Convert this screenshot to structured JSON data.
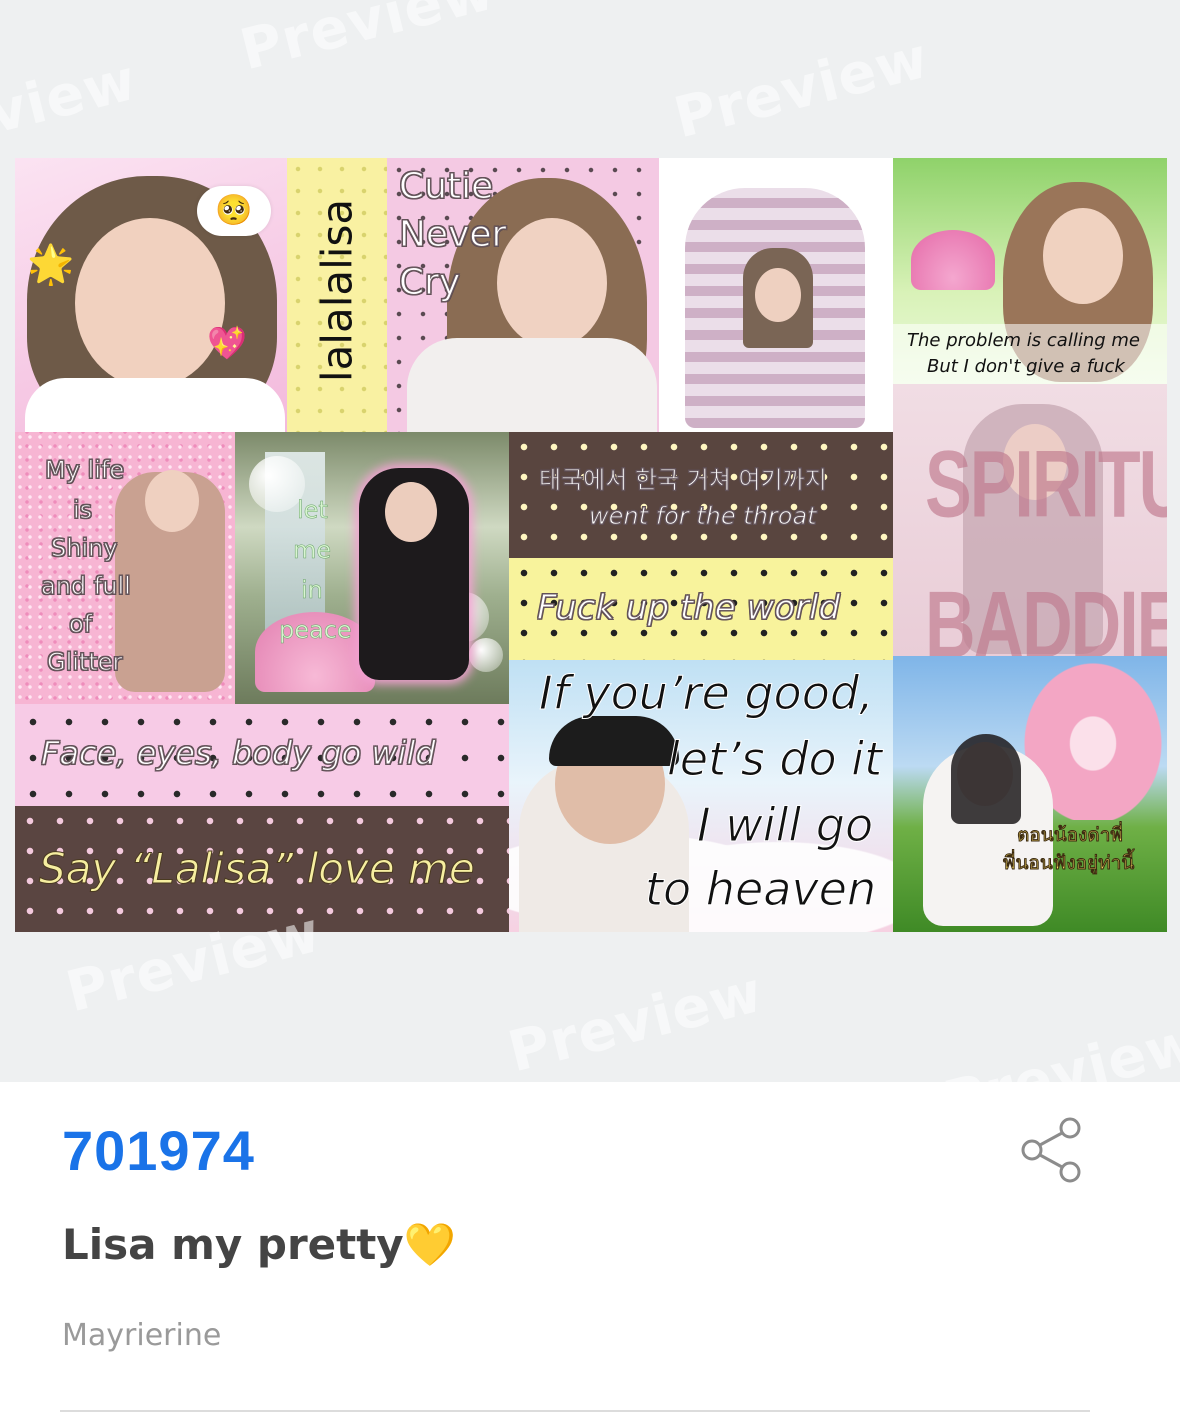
{
  "colors": {
    "accent_blue": "#1a73e8",
    "preview_bg": "#eef0f1",
    "title_text": "#444444",
    "author_text": "#9a9a9a"
  },
  "watermark": {
    "text": "Preview"
  },
  "collage": {
    "tile1": {
      "emoji": "🥺",
      "star": "🌟",
      "heart": "💖"
    },
    "tile2": {
      "text": "lalalalisa"
    },
    "tile3": {
      "line1": "Cutie",
      "line2": "Never",
      "line3": "Cry"
    },
    "tile5": {
      "line1": "The problem is calling me",
      "line2": "But I don't give a fuck"
    },
    "tile6": {
      "line1": "My life",
      "line2": "is",
      "line3": "Shiny",
      "line4": "and full",
      "line5": "of",
      "line6": "Glitter"
    },
    "tile7": {
      "line1": "let",
      "line2": "me",
      "line3": "in",
      "line4": "peace"
    },
    "tile8": {
      "line1": "태국에서 한국 거쳐 여기까지",
      "line2": "went for the throat"
    },
    "tile9": {
      "text": "SPIRITUAL BADDIE"
    },
    "tile10": {
      "text": "Fuck up the world"
    },
    "tile11": {
      "text": "Face, eyes, body go wild"
    },
    "tile12": {
      "line1": "If you’re good,",
      "line2": "let’s do it",
      "line3": "I will go",
      "line4": "to heaven"
    },
    "tile13": {
      "line1": "ตอนน้องด่าพี่",
      "line2": "พี่นอนฟังอยู่ท่านี้"
    },
    "tile14": {
      "text": "Say “Lalisa” love me"
    }
  },
  "post": {
    "id": "701974",
    "title": "Lisa my pretty💛",
    "author": "Mayrierine",
    "share_icon": "share-icon"
  }
}
